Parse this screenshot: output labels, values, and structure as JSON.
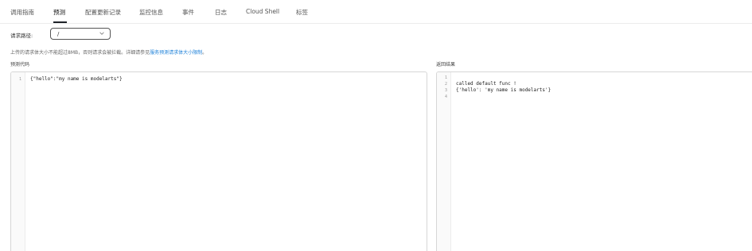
{
  "tabs": [
    {
      "label": "调用指南",
      "active": false
    },
    {
      "label": "预测",
      "active": true
    },
    {
      "label": "配置更新记录",
      "active": false
    },
    {
      "label": "监控信息",
      "active": false
    },
    {
      "label": "事件",
      "active": false
    },
    {
      "label": "日志",
      "active": false
    },
    {
      "label": "Cloud Shell",
      "active": false
    },
    {
      "label": "标签",
      "active": false
    }
  ],
  "request_path": {
    "label": "请求路径:",
    "value": "/"
  },
  "notice": {
    "text": "上传的请求体大小不能超过8MB，否则请求会被拦截。详细请参见",
    "link_text": "服务预测请求体大小限制",
    "suffix": "。"
  },
  "predict_code": {
    "label": "预测代码",
    "line_numbers": [
      "1"
    ],
    "lines": [
      "{\"hello\":\"my name is modelarts\"}"
    ]
  },
  "result": {
    "label": "返回结果",
    "line_numbers": [
      "1",
      "2",
      "3",
      "4"
    ],
    "lines": [
      "",
      "called default func !",
      "{'hello': 'my name is modelarts'}",
      ""
    ]
  },
  "colors": {
    "link": "#1a7fd8",
    "active_underline": "#1f2329",
    "border": "#d6d6d6"
  },
  "icons": {
    "select_chevron": "chevron-down-icon"
  }
}
